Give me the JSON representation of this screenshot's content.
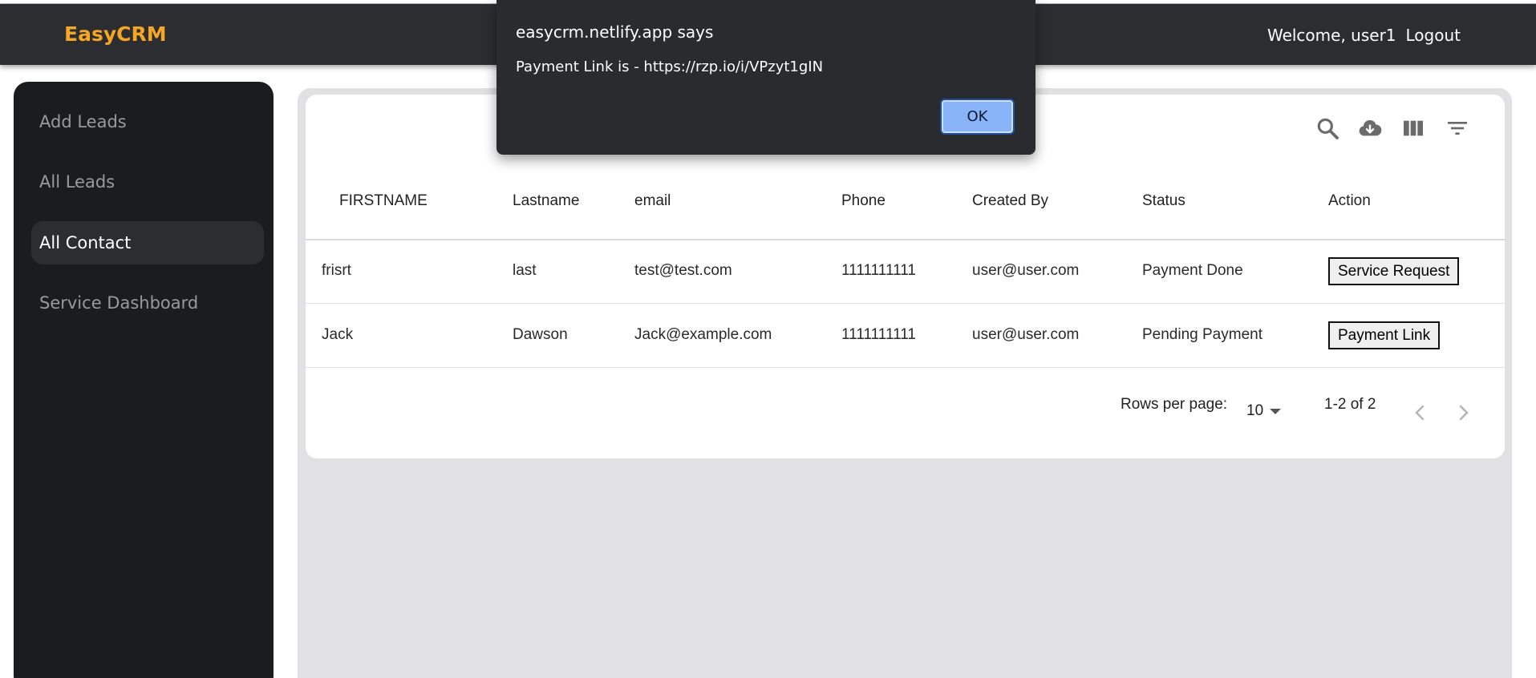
{
  "navbar": {
    "brand": "EasyCRM",
    "welcome": "Welcome, user1",
    "logout": "Logout"
  },
  "sidebar": {
    "items": [
      {
        "label": "Add Leads"
      },
      {
        "label": "All Leads"
      },
      {
        "label": "All Contact",
        "active": true
      },
      {
        "label": "Service Dashboard"
      }
    ]
  },
  "toolbar": {
    "icons": [
      "search-icon",
      "cloud-download-icon",
      "view-columns-icon",
      "filter-icon"
    ]
  },
  "table": {
    "columns": [
      "FIRSTNAME",
      "Lastname",
      "email",
      "Phone",
      "Created By",
      "Status",
      "Action"
    ],
    "rows": [
      {
        "firstname": "frisrt",
        "lastname": "last",
        "email": "test@test.com",
        "phone": "1111111111",
        "created_by": "user@user.com",
        "status": "Payment Done",
        "action": "Service Request"
      },
      {
        "firstname": "Jack",
        "lastname": "Dawson",
        "email": "Jack@example.com",
        "phone": "1111111111",
        "created_by": "user@user.com",
        "status": "Pending Payment",
        "action": "Payment Link"
      }
    ]
  },
  "pagination": {
    "rows_per_page_label": "Rows per page:",
    "rows_per_page_value": "10",
    "range": "1-2 of 2"
  },
  "dialog": {
    "title": "easycrm.netlify.app says",
    "message": "Payment Link is - https://rzp.io/i/VPzyt1gIN",
    "ok_label": "OK"
  },
  "colors": {
    "brand": "#f5a623",
    "navbar": "#2b2d31",
    "sidebar": "#1b1c1e",
    "dialog": "#2a2b2f",
    "ok_button": "#89b4f8"
  }
}
